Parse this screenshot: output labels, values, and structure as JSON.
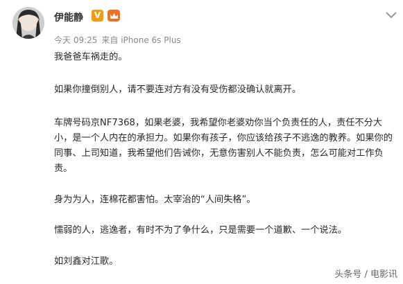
{
  "user": {
    "name": "伊能静",
    "verified_badge": "V"
  },
  "meta": {
    "time": "今天 09:25",
    "source": "来自 iPhone 6s Plus"
  },
  "post": {
    "paragraphs": [
      "我爸爸车祸走的。",
      "如果你撞倒别人，请不要连对方有没有受伤都没确认就离开。",
      "车牌号码京NF7368，如果老婆，我希望你老婆劝你当个负责任的人，责任不分大小，是一个人内在的承担力。如果你有孩子，你应该给孩子不逃逸的教养。如果你的同事、上司知道，我希望他们告诫你，无意伤害别人不能负责，怎么可能对工作负责。",
      "身为为人，连棉花都害怕。太宰治的“人间失格”。",
      "懦弱的人，逃逸者，有时不为了争什么，只是需要一个道歉、一个说法。",
      "如刘鑫对江歌。"
    ]
  },
  "watermark": "头条号 / 电影讯",
  "colors": {
    "verified": "#f39c12",
    "member": "#f36f21",
    "meta_text": "#888888"
  },
  "icons": [
    "verified-v-icon",
    "member-crown-icon",
    "chevron-down-icon"
  ]
}
